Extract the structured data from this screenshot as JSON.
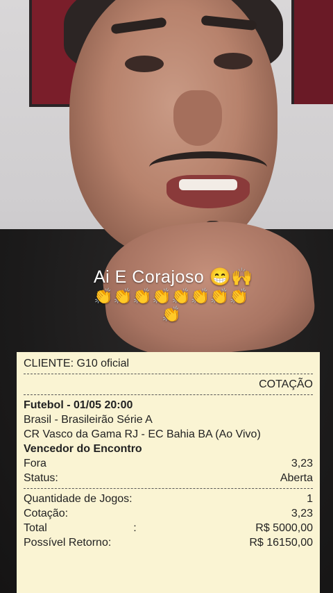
{
  "video": {
    "caption_line1": "Ai E Corajoso 😁🙌",
    "caption_emojis_row1": "👏👏👏👏👏👏👏👏",
    "caption_emojis_row2": "👏"
  },
  "receipt": {
    "cliente_label": "CLIENTE:",
    "cliente_value": "G10 oficial",
    "cotacao_header": "COTAÇÃO",
    "event_header": "Futebol - 01/05 20:00",
    "league": "Brasil - Brasileirão Série A",
    "match": "CR Vasco da Gama RJ - EC Bahia BA (Ao Vivo)",
    "market": "Vencedor do Encontro",
    "pick_label": "Fora",
    "pick_odds": "3,23",
    "status_label": "Status:",
    "status_value": "Aberta",
    "quantidade_label": "Quantidade de Jogos:",
    "quantidade_value": "1",
    "cotacao_label": "Cotação:",
    "cotacao_value": "3,23",
    "total_label": "Total",
    "total_colon": ":",
    "total_value": "R$ 5000,00",
    "retorno_label": "Possível Retorno:",
    "retorno_value": "R$ 16150,00"
  }
}
